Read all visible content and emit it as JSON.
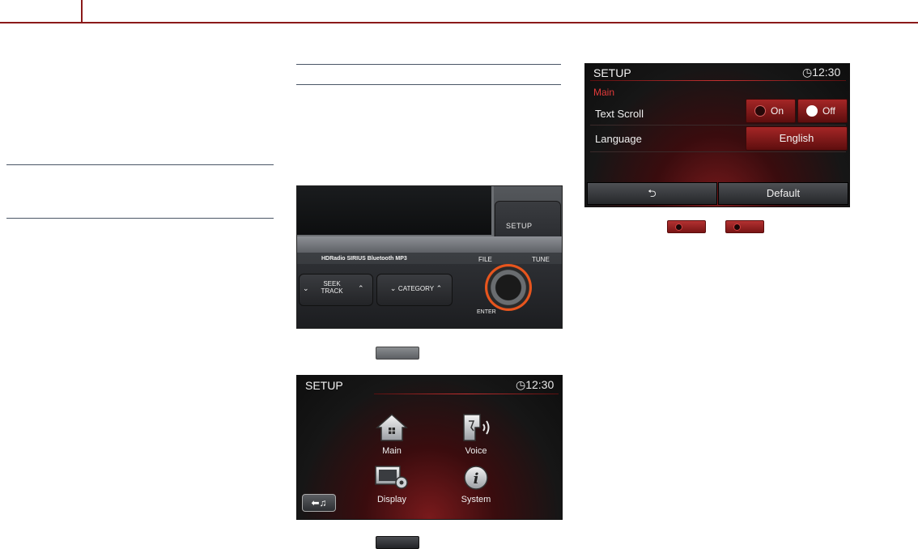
{
  "device": {
    "setup_label": "SETUP",
    "logos": "HDRadio  SIRIUS  Bluetooth  MP3",
    "seek_label_1": "SEEK",
    "seek_label_2": "TRACK",
    "category_label": "CATEGORY",
    "file_label": "FILE",
    "tune_label": "TUNE",
    "enter_label": "ENTER"
  },
  "setup_menu": {
    "title": "SETUP",
    "clock": "12:30",
    "items": [
      {
        "label": "Main",
        "icon": "home-icon"
      },
      {
        "label": "Voice",
        "icon": "voice-icon"
      },
      {
        "label": "Display",
        "icon": "display-settings-icon"
      },
      {
        "label": "System",
        "icon": "info-icon"
      }
    ],
    "back_icon": "back-music-icon"
  },
  "setup_main": {
    "title": "SETUP",
    "clock": "12:30",
    "section": "Main",
    "section_color": "#e23a3a",
    "text_scroll_label": "Text Scroll",
    "on_label": "On",
    "off_label": "Off",
    "text_scroll_selected": "Off",
    "language_label": "Language",
    "language_value": "English",
    "default_label": "Default"
  }
}
